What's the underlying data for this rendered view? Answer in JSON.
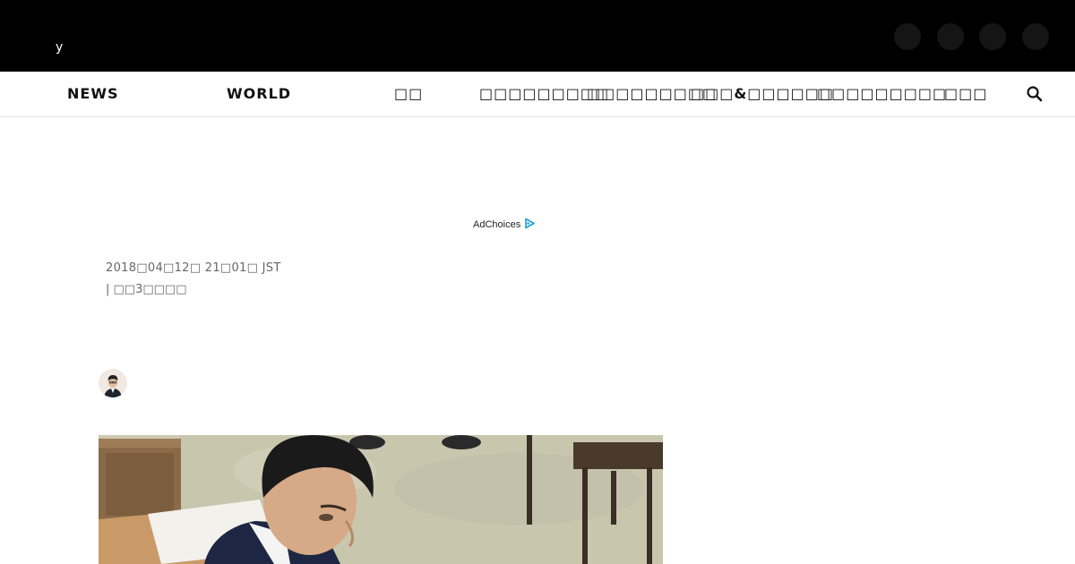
{
  "header": {
    "logo_text": "y",
    "social_icons": [
      "social-icon-1",
      "social-icon-2",
      "social-icon-3",
      "social-icon-4"
    ]
  },
  "nav": {
    "items": [
      {
        "label": "NEWS"
      },
      {
        "label": "WORLD"
      },
      {
        "label": "□□"
      },
      {
        "label": "□□□□□□□□□"
      },
      {
        "label": "□□□□□□□□□"
      },
      {
        "label": "□□□&□□□□□□"
      },
      {
        "label": "□□□□□□□□□"
      },
      {
        "label": "□□□"
      }
    ],
    "search_icon": "search-icon"
  },
  "ad": {
    "label": "AdChoices",
    "icon": "adchoices-icon"
  },
  "article": {
    "date": "2018□04□12□ 21□01□ JST",
    "comments": "| □□3□□□□"
  },
  "colors": {
    "topbar": "#000000",
    "nav_text": "#111111",
    "meta_text": "#666666",
    "adchoices_blue": "#1a9dd9"
  }
}
